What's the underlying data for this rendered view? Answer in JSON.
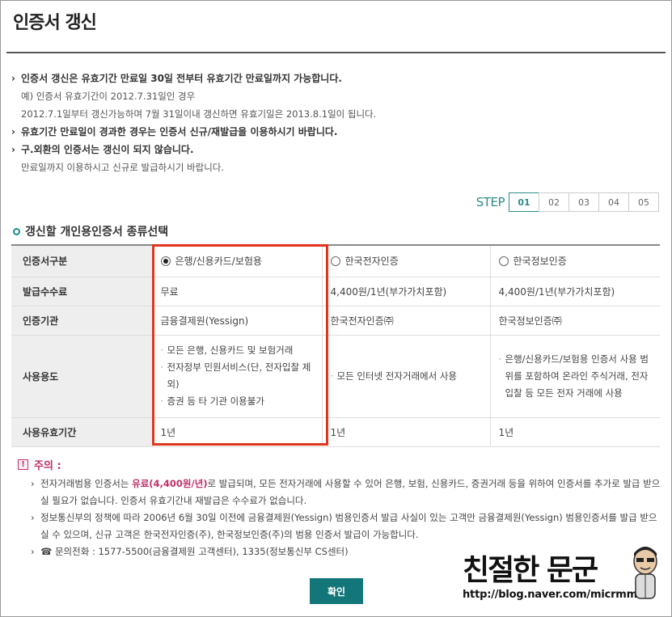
{
  "page": {
    "title": "인증서 갱신"
  },
  "notes": [
    {
      "text": "인증서 갱신은 유효기간 만료일 30일 전부터 유효기간 만료일까지 가능합니다.",
      "subs": [
        "예) 인증서 유효기간이 2012.7.31일인 경우",
        "2012.7.1일부터 갱신가능하며 7월 31일이내 갱신하면 유효기일은 2013.8.1일이 됩니다."
      ]
    },
    {
      "text": "유효기간 만료일이 경과한 경우는 인증서 신규/재발급을 이용하시기 바랍니다.",
      "subs": []
    },
    {
      "text": "구.외환의 인증서는 갱신이 되지 않습니다.",
      "subs": [
        "만료일까지 이용하시고 신규로 발급하시기 바랍니다."
      ]
    }
  ],
  "steps": {
    "label": "STEP",
    "items": [
      "01",
      "02",
      "03",
      "04",
      "05"
    ],
    "active_index": 0,
    "accent": "#2e8c86"
  },
  "section": {
    "title": "갱신할 개인용인증서 종류선택"
  },
  "table": {
    "rows": [
      {
        "header": "인증서구분",
        "kind": "radio",
        "cells": [
          "은행/신용카드/보험용",
          "한국전자인증",
          "한국정보인증"
        ],
        "selected": 0
      },
      {
        "header": "발급수수료",
        "kind": "text",
        "cells": [
          "무료",
          "4,400원/1년(부가가치포함)",
          "4,400원/1년(부가가치포함)"
        ]
      },
      {
        "header": "인증기관",
        "kind": "text",
        "cells": [
          "금융결제원(Yessign)",
          "한국전자인증㈜",
          "한국정보인증㈜"
        ]
      },
      {
        "header": "사용용도",
        "kind": "list",
        "cells": [
          [
            "모든 은행, 신용카드 및 보험거래",
            "전자정부 민원서비스(단, 전자입찰 제외)",
            "증권 등 타 기관 이용불가"
          ],
          [
            "모든 인터넷 전자거래에서 사용"
          ],
          [
            "은행/신용카드/보험용 인증서 사용 범위를 포함하여 온라인 주식거래, 전자입찰 등 모든 전자 거래에 사용"
          ]
        ]
      },
      {
        "header": "사용유효기간",
        "kind": "text",
        "cells": [
          "1년",
          "1년",
          "1년"
        ]
      }
    ]
  },
  "caution": {
    "title": "주의 :",
    "icon": "!",
    "items": [
      {
        "before": "전자거래범용 인증서는 ",
        "highlight": "유료(4,400원/년)",
        "after": "로 발급되며, 모든 전자거래에 사용할 수 있어 은행, 보험, 신용카드, 증권거래 등을 위하여 인증서를 추가로 발급 받으실 필요가 없습니다. 인증서 유효기간내 재발급은 수수료가 없습니다."
      },
      {
        "before": "정보통신부의 정책에 따라 2006년 6월 30일 이전에 금융결제원(Yessign) 범용인증서 발급 사실이 있는 고객만 금융결제원(Yessign) 범용인증서를 발급 받으실 수 있으며, 신규 고객은 한국전자인증(주), 한국정보인증(주)의 범용 인증서 발급이 가능합니다.",
        "highlight": "",
        "after": ""
      },
      {
        "before": "☎ 문의전화 : 1577-5500(금융결제원 고객센터), 1335(정보통신부 CS센터)",
        "highlight": "",
        "after": ""
      }
    ],
    "highlight_color": "#c0306a"
  },
  "confirm_button": {
    "label": "확인",
    "color": "#13777a"
  },
  "watermark": {
    "title": "친절한 문군",
    "url": "http://blog.naver.com/micrmm"
  }
}
